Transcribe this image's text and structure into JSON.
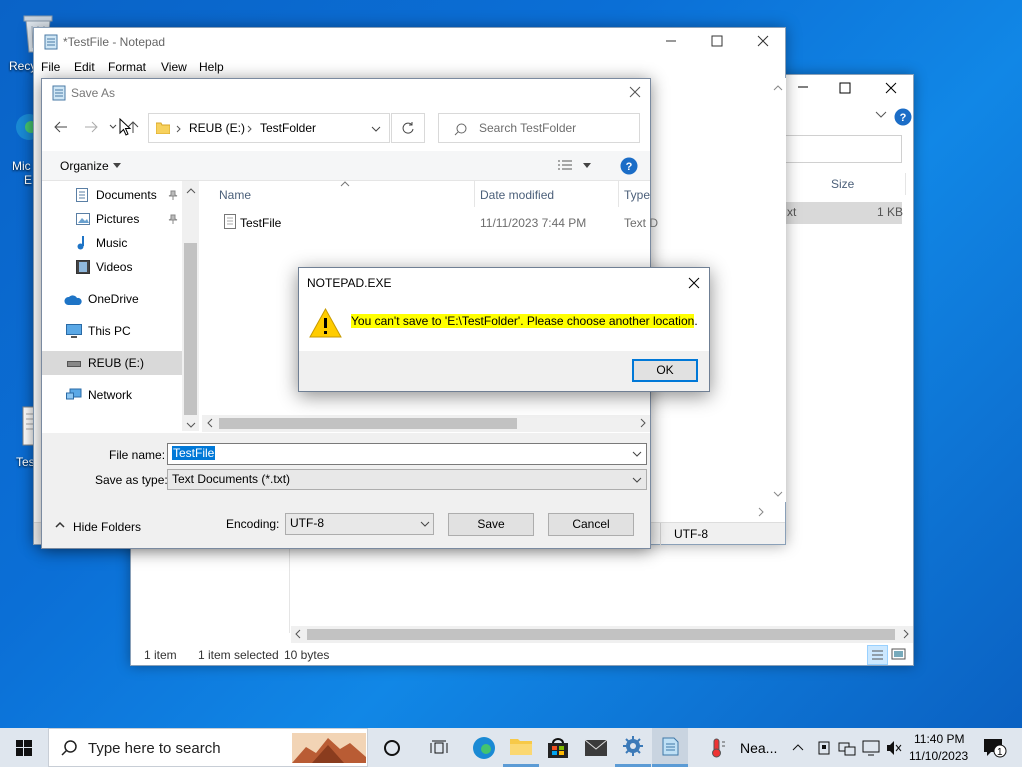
{
  "desktop": {
    "recycle_label": "Recy",
    "edge_label_1": "Mic",
    "edge_label_2": "E",
    "file_label": "Tes"
  },
  "explorer": {
    "col_size": "Size",
    "row_partial": "xt",
    "row_size": "1 KB",
    "status_items": "1 item",
    "status_selected": "1 item selected",
    "status_bytes": "10 bytes"
  },
  "notepad": {
    "title": "*TestFile - Notepad",
    "menu": [
      "File",
      "Edit",
      "Format",
      "View",
      "Help"
    ],
    "status_encoding": "UTF-8"
  },
  "saveas": {
    "title": "Save As",
    "breadcrumb": [
      "REUB (E:)",
      "TestFolder"
    ],
    "search_placeholder": "Search TestFolder",
    "organize": "Organize",
    "nav": [
      {
        "label": "Documents",
        "icon": "documents-icon",
        "pinned": true
      },
      {
        "label": "Pictures",
        "icon": "pictures-icon",
        "pinned": true
      },
      {
        "label": "Music",
        "icon": "music-icon",
        "pinned": false
      },
      {
        "label": "Videos",
        "icon": "videos-icon",
        "pinned": false
      },
      {
        "label": "OneDrive",
        "icon": "onedrive-icon",
        "pinned": false
      },
      {
        "label": "This PC",
        "icon": "this-pc-icon",
        "pinned": false
      },
      {
        "label": "REUB (E:)",
        "icon": "drive-icon",
        "pinned": false,
        "selected": true
      },
      {
        "label": "Network",
        "icon": "network-icon",
        "pinned": false
      }
    ],
    "columns": {
      "name": "Name",
      "date": "Date modified",
      "type": "Type"
    },
    "files": [
      {
        "name": "TestFile",
        "date": "11/11/2023 7:44 PM",
        "type": "Text D"
      }
    ],
    "file_name_label": "File name:",
    "file_name_value": "TestFile",
    "save_type_label": "Save as type:",
    "save_type_value": "Text Documents (*.txt)",
    "hide_folders": "Hide Folders",
    "encoding_label": "Encoding:",
    "encoding_value": "UTF-8",
    "save_button": "Save",
    "cancel_button": "Cancel"
  },
  "alert": {
    "title": "NOTEPAD.EXE",
    "message_highlighted": "You can't save to 'E:\\TestFolder'. Please choose another location",
    "message_end": ".",
    "ok_button": "OK",
    "highlight_color": "#ffff00"
  },
  "taskbar": {
    "search_placeholder": "Type here to search",
    "weather": "Nea...",
    "time": "11:40 PM",
    "date": "11/10/2023",
    "notification_count": "1"
  },
  "colors": {
    "accent": "#0078d7",
    "selection": "#cce8ff",
    "warning": "#ffcc00"
  }
}
